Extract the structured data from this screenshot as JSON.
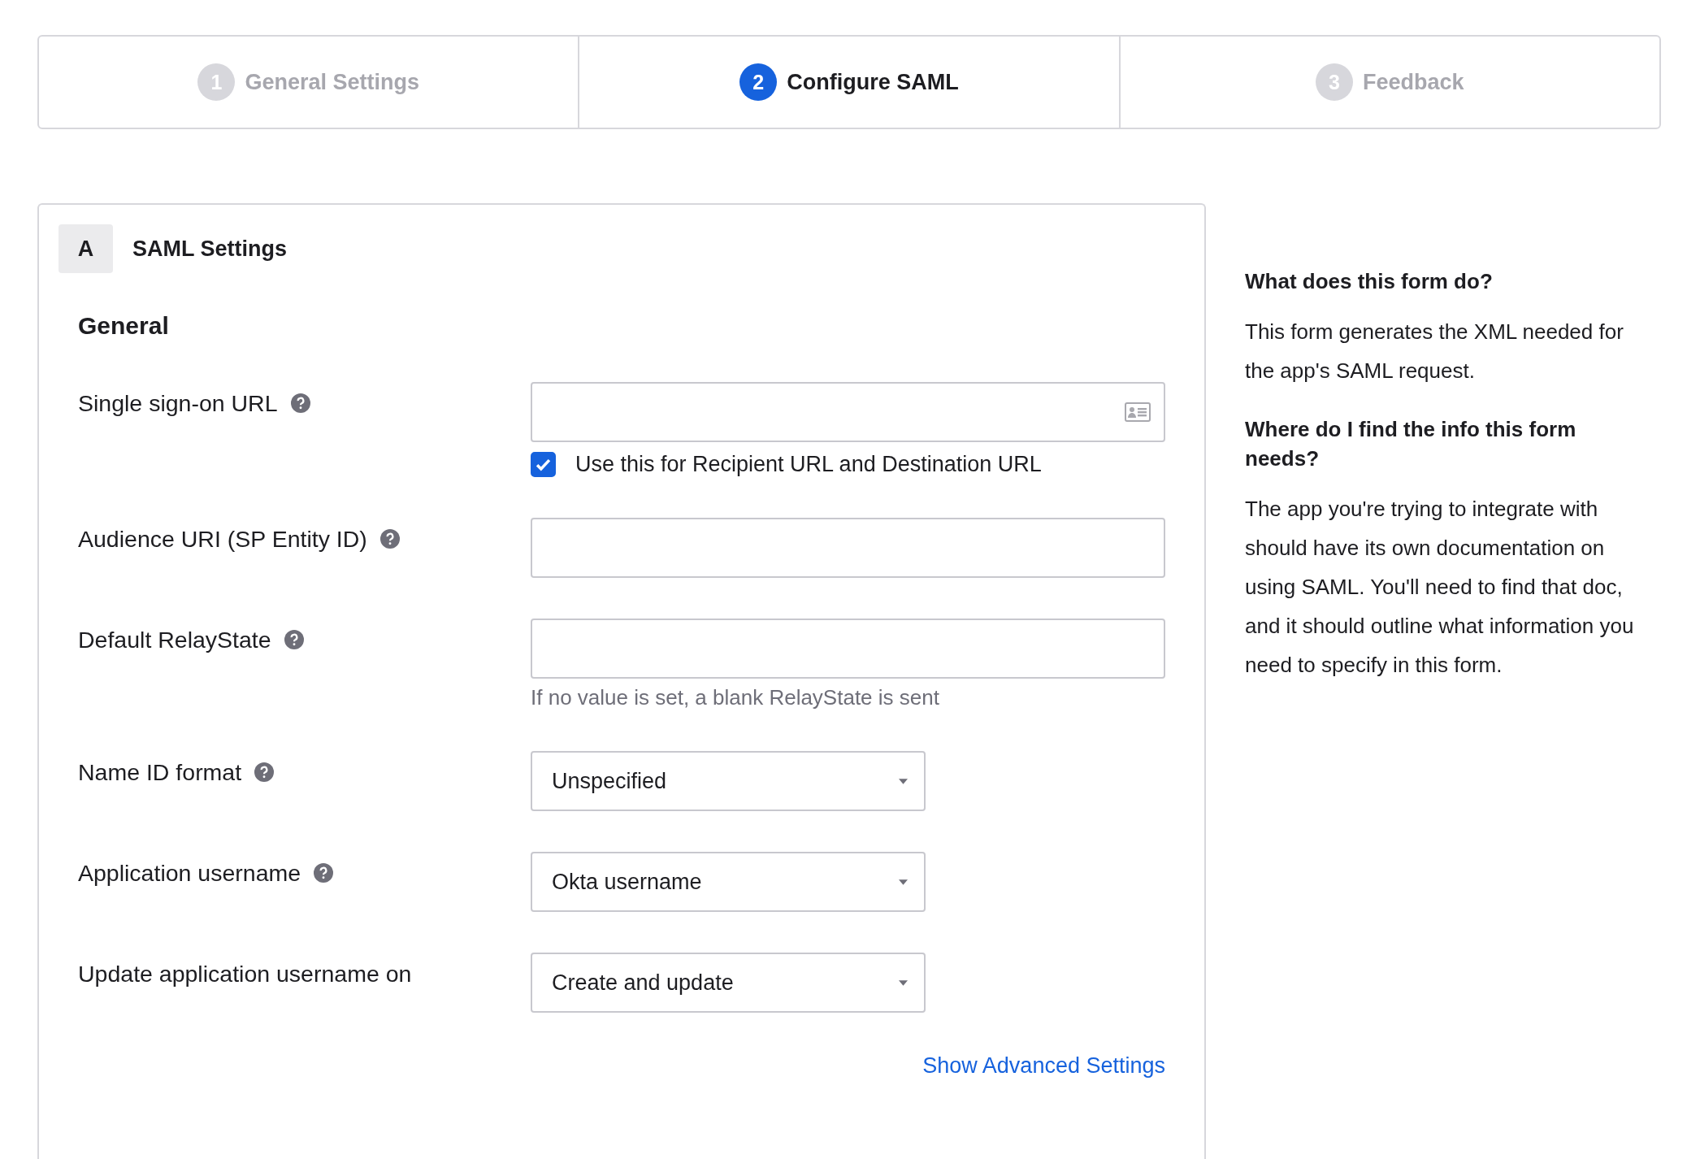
{
  "steps": [
    {
      "number": "1",
      "label": "General Settings",
      "selected": false
    },
    {
      "number": "2",
      "label": "Configure SAML",
      "selected": true
    },
    {
      "number": "3",
      "label": "Feedback",
      "selected": false
    }
  ],
  "section": {
    "letter": "A",
    "title": "SAML Settings",
    "heading": "General",
    "fields": [
      {
        "kind": "text",
        "label": "Single sign-on URL",
        "help": true,
        "contact_icon": true,
        "checkbox": {
          "label": "Use this for Recipient URL and Destination URL",
          "checked": true
        }
      },
      {
        "kind": "text",
        "label": "Audience URI (SP Entity ID)",
        "help": true
      },
      {
        "kind": "text",
        "label": "Default RelayState",
        "help": true,
        "hint": "If no value is set, a blank RelayState is sent"
      },
      {
        "kind": "select",
        "label": "Name ID format",
        "help": true,
        "value": "Unspecified"
      },
      {
        "kind": "select",
        "label": "Application username",
        "help": true,
        "value": "Okta username"
      },
      {
        "kind": "select",
        "label": "Update application username on",
        "help": false,
        "value": "Create and update"
      }
    ],
    "link": "Show Advanced Settings"
  },
  "help": [
    {
      "kind": "heading",
      "text": "What does this form do?"
    },
    {
      "kind": "paragraph",
      "text": "This form generates the XML needed for the app's SAML request."
    },
    {
      "kind": "heading",
      "text": "Where do I find the info this form needs?"
    },
    {
      "kind": "paragraph",
      "text": "The app you're trying to integrate with should have its own documentation on using SAML. You'll need to find that doc, and it should outline what information you need to specify in this form."
    }
  ]
}
